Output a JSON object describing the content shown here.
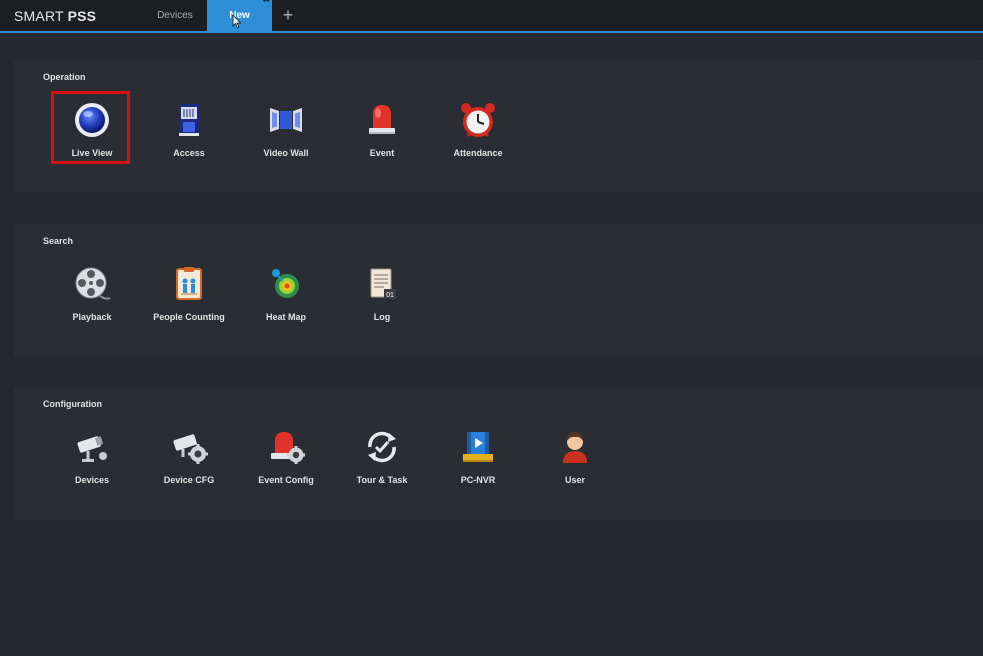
{
  "app": {
    "logo_light": "SMART ",
    "logo_bold": "PSS"
  },
  "tabs": [
    {
      "label": "Devices",
      "active": false
    },
    {
      "label": "New",
      "active": true
    }
  ],
  "add_tab_icon": "+",
  "sections": {
    "operation": {
      "title": "Operation",
      "items": [
        {
          "label": "Live View",
          "icon": "live-view-icon",
          "highlighted": true
        },
        {
          "label": "Access",
          "icon": "access-icon"
        },
        {
          "label": "Video Wall",
          "icon": "video-wall-icon"
        },
        {
          "label": "Event",
          "icon": "alarm-light-icon"
        },
        {
          "label": "Attendance",
          "icon": "alarm-clock-icon"
        }
      ]
    },
    "search": {
      "title": "Search",
      "items": [
        {
          "label": "Playback",
          "icon": "film-reel-icon"
        },
        {
          "label": "People Counting",
          "icon": "people-counting-icon"
        },
        {
          "label": "Heat Map",
          "icon": "heat-map-icon"
        },
        {
          "label": "Log",
          "icon": "log-icon"
        }
      ]
    },
    "configuration": {
      "title": "Configuration",
      "items": [
        {
          "label": "Devices",
          "icon": "camera-icon"
        },
        {
          "label": "Device CFG",
          "icon": "camera-settings-icon"
        },
        {
          "label": "Event Config",
          "icon": "alarm-settings-icon"
        },
        {
          "label": "Tour & Task",
          "icon": "tour-task-icon"
        },
        {
          "label": "PC-NVR",
          "icon": "pc-nvr-icon"
        },
        {
          "label": "User",
          "icon": "user-icon"
        }
      ]
    }
  },
  "colors": {
    "accent": "#2e8fd8",
    "highlight": "#d41212",
    "background": "#25282e",
    "panel": "#2a2d33"
  }
}
